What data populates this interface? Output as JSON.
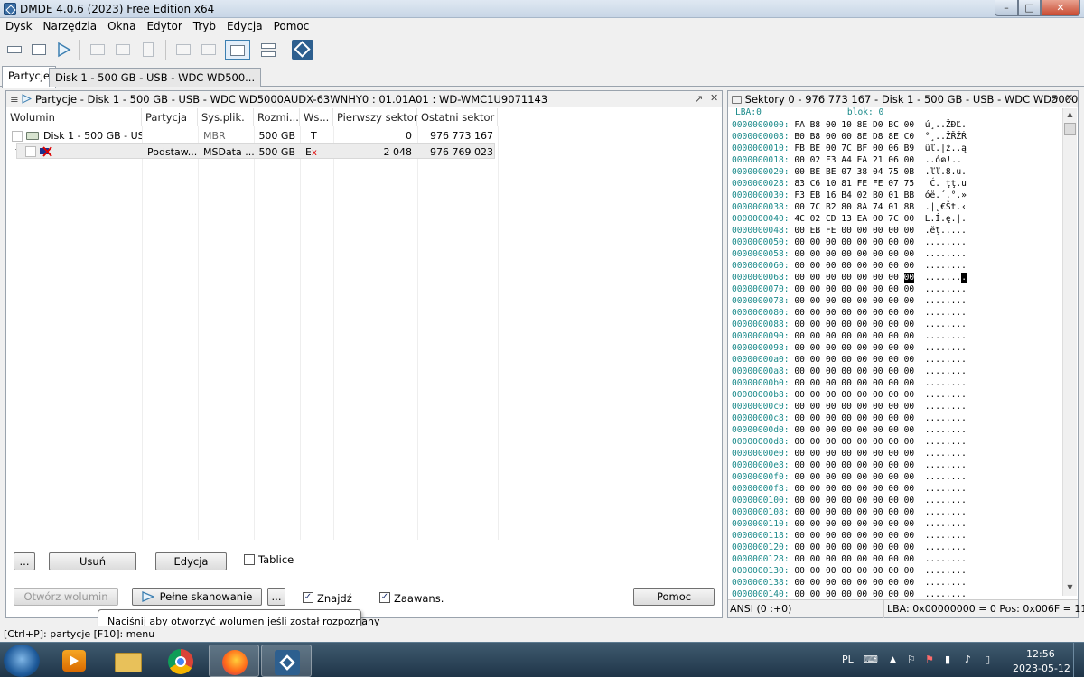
{
  "window": {
    "title": "DMDE 4.0.6 (2023) Free Edition x64",
    "min": "–",
    "max": "□",
    "close": "✕"
  },
  "menu": [
    "Dysk",
    "Narzędzia",
    "Okna",
    "Edytor",
    "Tryb",
    "Edycja",
    "Pomoc"
  ],
  "tabs": {
    "t1": "Partycje",
    "t2": "Disk 1 - 500 GB - USB - WDC WD500..."
  },
  "left_panel": {
    "title": "Partycje - Disk 1 - 500 GB - USB - WDC WD5000AUDX-63WNHY0 : 01.01A01 : WD-WMC1U9071143",
    "columns": [
      "Wolumin",
      "Partycja",
      "Sys.plik.",
      "Rozmi...",
      "Ws...",
      "Pierwszy sektor",
      "Ostatni sektor"
    ],
    "rows": [
      {
        "wolumin": "Disk 1 - 500 GB - US...",
        "partycja": "",
        "sys": "MBR",
        "rozmiar": "500 GB",
        "ws": "T",
        "first": "0",
        "last": "976 773 167"
      },
      {
        "wolumin": "",
        "partycja": "Podstaw...",
        "sys": "MSData ...",
        "rozmiar": "500 GB",
        "ws": "E",
        "ws2": "x",
        "first": "2 048",
        "last": "976 769 023"
      }
    ],
    "buttons": {
      "more": "...",
      "usun": "Usuń",
      "edycja": "Edycja",
      "tablice": "Tablice",
      "otworz": "Otwórz wolumin",
      "skan": "Pełne skanowanie",
      "more2": "...",
      "znajdz": "Znajdź",
      "zaawans": "Zaawans.",
      "pomoc": "Pomoc"
    },
    "checks": {
      "tablice": false,
      "znajdz": true,
      "zaawans": true
    },
    "tooltip": "Naciśnij aby otworzyć wolumen jeśli został rozpoznany"
  },
  "right_panel": {
    "title": "Sektory 0 - 976 773 167 - Disk 1 - 500 GB - USB - WDC WD5000AUD...",
    "lba": "LBA:0",
    "blok": "blok: 0",
    "cursor": {
      "row": 13,
      "col": 7
    },
    "hex_lines": [
      {
        "off": "0000000000:",
        "bytes": "FA B8 00 10 8E D0 BC 00",
        "ascii": "ú¸..ŽĐĽ."
      },
      {
        "off": "0000000008:",
        "bytes": "B0 B8 00 00 8E D8 8E C0",
        "ascii": "°¸..ŽŘŽŔ"
      },
      {
        "off": "0000000010:",
        "bytes": "FB BE 00 7C BF 00 06 B9",
        "ascii": "űľ.|ż..ą"
      },
      {
        "off": "0000000018:",
        "bytes": "00 02 F3 A4 EA 21 06 00",
        "ascii": "..óค!.."
      },
      {
        "off": "0000000020:",
        "bytes": "00 BE BE 07 38 04 75 0B",
        "ascii": ".ľľ.8.u."
      },
      {
        "off": "0000000028:",
        "bytes": "83 C6 10 81 FE FE 07 75",
        "ascii": " Ć. ţţ.u"
      },
      {
        "off": "0000000030:",
        "bytes": "F3 EB 16 B4 02 B0 01 BB",
        "ascii": "óë.´.°.»"
      },
      {
        "off": "0000000038:",
        "bytes": "00 7C B2 80 8A 74 01 8B",
        "ascii": ".|˛€Št.‹"
      },
      {
        "off": "0000000040:",
        "bytes": "4C 02 CD 13 EA 00 7C 00",
        "ascii": "L.Í.ę.|."
      },
      {
        "off": "0000000048:",
        "bytes": "00 EB FE 00 00 00 00 00",
        "ascii": ".ëţ....."
      },
      {
        "off": "0000000050:",
        "bytes": "00 00 00 00 00 00 00 00",
        "ascii": "........"
      },
      {
        "off": "0000000058:",
        "bytes": "00 00 00 00 00 00 00 00",
        "ascii": "........"
      },
      {
        "off": "0000000060:",
        "bytes": "00 00 00 00 00 00 00 00",
        "ascii": "........"
      },
      {
        "off": "0000000068:",
        "bytes": "00 00 00 00 00 00 00 00",
        "ascii": "........"
      },
      {
        "off": "0000000070:",
        "bytes": "00 00 00 00 00 00 00 00",
        "ascii": "........"
      },
      {
        "off": "0000000078:",
        "bytes": "00 00 00 00 00 00 00 00",
        "ascii": "........"
      },
      {
        "off": "0000000080:",
        "bytes": "00 00 00 00 00 00 00 00",
        "ascii": "........"
      },
      {
        "off": "0000000088:",
        "bytes": "00 00 00 00 00 00 00 00",
        "ascii": "........"
      },
      {
        "off": "0000000090:",
        "bytes": "00 00 00 00 00 00 00 00",
        "ascii": "........"
      },
      {
        "off": "0000000098:",
        "bytes": "00 00 00 00 00 00 00 00",
        "ascii": "........"
      },
      {
        "off": "00000000a0:",
        "bytes": "00 00 00 00 00 00 00 00",
        "ascii": "........"
      },
      {
        "off": "00000000a8:",
        "bytes": "00 00 00 00 00 00 00 00",
        "ascii": "........"
      },
      {
        "off": "00000000b0:",
        "bytes": "00 00 00 00 00 00 00 00",
        "ascii": "........"
      },
      {
        "off": "00000000b8:",
        "bytes": "00 00 00 00 00 00 00 00",
        "ascii": "........"
      },
      {
        "off": "00000000c0:",
        "bytes": "00 00 00 00 00 00 00 00",
        "ascii": "........"
      },
      {
        "off": "00000000c8:",
        "bytes": "00 00 00 00 00 00 00 00",
        "ascii": "........"
      },
      {
        "off": "00000000d0:",
        "bytes": "00 00 00 00 00 00 00 00",
        "ascii": "........"
      },
      {
        "off": "00000000d8:",
        "bytes": "00 00 00 00 00 00 00 00",
        "ascii": "........"
      },
      {
        "off": "00000000e0:",
        "bytes": "00 00 00 00 00 00 00 00",
        "ascii": "........"
      },
      {
        "off": "00000000e8:",
        "bytes": "00 00 00 00 00 00 00 00",
        "ascii": "........"
      },
      {
        "off": "00000000f0:",
        "bytes": "00 00 00 00 00 00 00 00",
        "ascii": "........"
      },
      {
        "off": "00000000f8:",
        "bytes": "00 00 00 00 00 00 00 00",
        "ascii": "........"
      },
      {
        "off": "0000000100:",
        "bytes": "00 00 00 00 00 00 00 00",
        "ascii": "........"
      },
      {
        "off": "0000000108:",
        "bytes": "00 00 00 00 00 00 00 00",
        "ascii": "........"
      },
      {
        "off": "0000000110:",
        "bytes": "00 00 00 00 00 00 00 00",
        "ascii": "........"
      },
      {
        "off": "0000000118:",
        "bytes": "00 00 00 00 00 00 00 00",
        "ascii": "........"
      },
      {
        "off": "0000000120:",
        "bytes": "00 00 00 00 00 00 00 00",
        "ascii": "........"
      },
      {
        "off": "0000000128:",
        "bytes": "00 00 00 00 00 00 00 00",
        "ascii": "........"
      },
      {
        "off": "0000000130:",
        "bytes": "00 00 00 00 00 00 00 00",
        "ascii": "........"
      },
      {
        "off": "0000000138:",
        "bytes": "00 00 00 00 00 00 00 00",
        "ascii": "........"
      },
      {
        "off": "0000000140:",
        "bytes": "00 00 00 00 00 00 00 00",
        "ascii": "........"
      }
    ],
    "status_ansi": "ANSI (0 :+0)",
    "status_lba": "LBA: 0x00000000 = 0  Pos: 0x006F = 111"
  },
  "statusbar": "[Ctrl+P]: partycje  [F10]: menu",
  "taskbar": {
    "lang": "PL",
    "time": "12:56",
    "date": "2023-05-12"
  },
  "colors": {
    "offset": "#1a8a8a",
    "accent": "#3a6ea5",
    "taskbar": "#2a4459"
  }
}
